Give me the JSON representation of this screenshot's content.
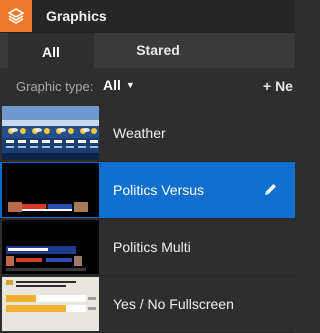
{
  "header": {
    "title": "Graphics",
    "icon": "layers-icon",
    "accent": "#ec7a2b"
  },
  "tabs": [
    {
      "label": "All",
      "active": true
    },
    {
      "label": "Stared",
      "active": false
    }
  ],
  "filter": {
    "label": "Graphic type:",
    "value": "All",
    "new_label": "+ Ne"
  },
  "list": {
    "items": [
      {
        "label": "Weather",
        "thumbnail": "weather-thumbnail",
        "selected": false
      },
      {
        "label": "Politics Versus",
        "thumbnail": "politics-versus-thumbnail",
        "selected": true,
        "action_icon": "pencil-icon"
      },
      {
        "label": "Politics Multi",
        "thumbnail": "politics-multi-thumbnail",
        "selected": false
      },
      {
        "label": "Yes / No Fullscreen",
        "thumbnail": "yes-no-thumbnail",
        "selected": false
      }
    ]
  },
  "colors": {
    "selected_row": "#0f6fcf",
    "background": "#2e2e2e"
  }
}
